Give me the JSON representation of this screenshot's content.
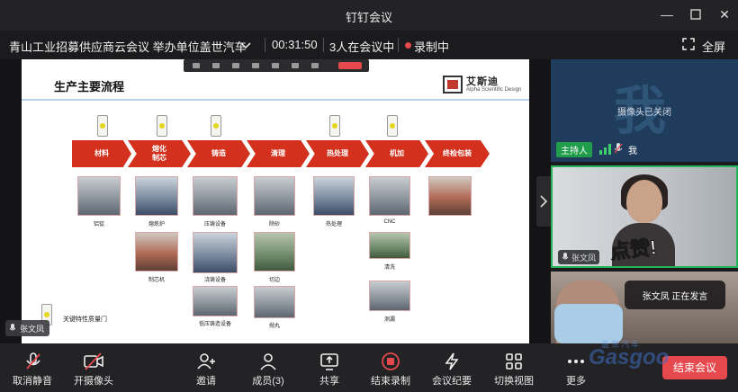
{
  "window": {
    "title": "钉钉会议"
  },
  "infobar": {
    "topic": "青山工业招募供应商云会议 举办单位盖世汽车",
    "timer": "00:31:50",
    "participants_count": "3人在会议中",
    "recording": "录制中",
    "fullscreen": "全屏"
  },
  "slide": {
    "title": "生产主要流程",
    "logo_cn": "艾斯迪",
    "logo_en": "Alpha Scientific Design",
    "steps": [
      "材料",
      "熔化\n制芯",
      "铸造",
      "清理",
      "热处理",
      "机加",
      "终检包装"
    ],
    "captions": {
      "c1": "铝锭",
      "c2": "熔炼炉",
      "c3": "制芯机",
      "c4": "压铸设备",
      "c5": "浇铸设备",
      "c6": "低压铸造设备",
      "c7": "除砂",
      "c8": "切边",
      "c9": "抛丸",
      "c10": "热处理",
      "c11": "CNC",
      "c12": "清洗",
      "c13": "测漏"
    },
    "quality_gate": "关键特性质量门",
    "colors": {
      "arrow": "#d3301d",
      "light": "#e6d620"
    }
  },
  "speaker_chip": {
    "name": "张文凤"
  },
  "participants": {
    "me": {
      "camera_off": "摄像头已关闭",
      "big_label": "我",
      "host_badge": "主持人",
      "name": "我"
    },
    "p2": {
      "name": "张文凤",
      "sticker": "点赞!"
    },
    "p3": {
      "speaking": "张文凤 正在发言"
    }
  },
  "toolbar": {
    "mute": "取消静音",
    "camera": "开摄像头",
    "invite": "邀请",
    "members": "成员(3)",
    "share": "共享",
    "end_record": "结束录制",
    "minutes": "会议纪要",
    "view": "切换视图",
    "more": "更多",
    "end_meeting": "结束会议"
  },
  "watermark": {
    "top": "盖世汽车",
    "brand": "Gasgoo"
  }
}
